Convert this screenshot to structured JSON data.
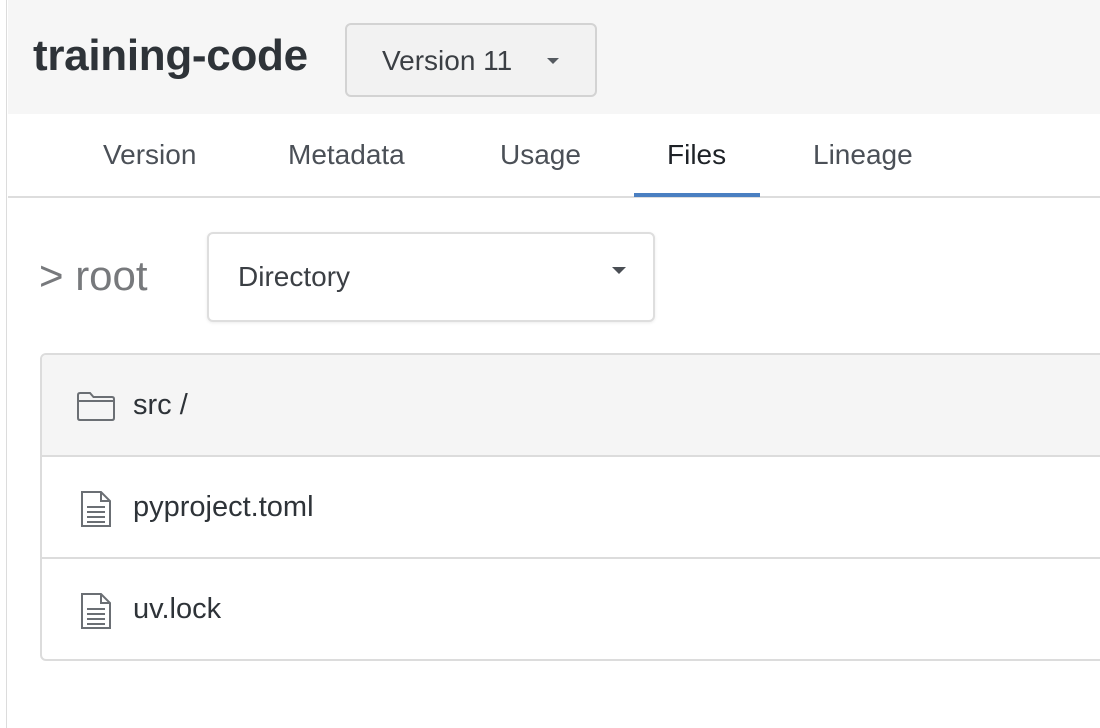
{
  "header": {
    "title": "training-code",
    "version_select": {
      "value": "Version 11",
      "icon": "caret-down-icon"
    }
  },
  "tabs": [
    {
      "label": "Version",
      "active": false
    },
    {
      "label": "Metadata",
      "active": false
    },
    {
      "label": "Usage",
      "active": false
    },
    {
      "label": "Files",
      "active": true
    },
    {
      "label": "Lineage",
      "active": false
    }
  ],
  "colors": {
    "accent": "#4a7fc1",
    "header_bg": "#f6f6f6",
    "border": "#dcdcdc"
  },
  "files": {
    "breadcrumb": "> root",
    "view_select": {
      "value": "Directory",
      "icon": "caret-down-icon"
    },
    "rows": [
      {
        "name": "src /",
        "type": "folder",
        "icon": "folder-icon"
      },
      {
        "name": "pyproject.toml",
        "type": "file",
        "icon": "file-icon"
      },
      {
        "name": "uv.lock",
        "type": "file",
        "icon": "file-icon"
      }
    ]
  }
}
